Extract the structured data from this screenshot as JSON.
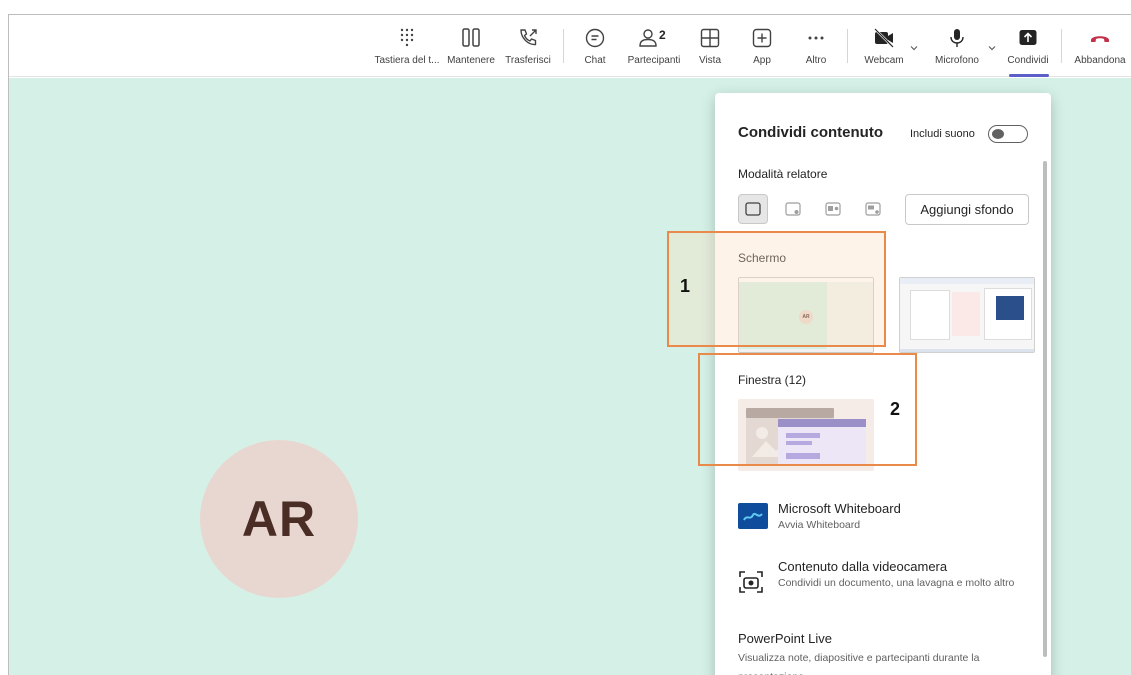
{
  "toolbar": {
    "dialpad_label": "Tastiera del t...",
    "hold_label": "Mantenere",
    "transfer_label": "Trasferisci",
    "chat_label": "Chat",
    "participants_label": "Partecipanti",
    "participants_count": "2",
    "view_label": "Vista",
    "apps_label": "App",
    "more_label": "Altro",
    "webcam_label": "Webcam",
    "mic_label": "Microfono",
    "share_label": "Condividi",
    "leave_label": "Abbandona",
    "leave_color": "#c4314b",
    "accent": "#5b5fc7"
  },
  "stage": {
    "avatar_initials": "AR",
    "background": "#d5f1e7"
  },
  "share_panel": {
    "title": "Condividi contenuto",
    "include_sound_label": "Includi suono",
    "include_sound_on": false,
    "presenter_mode_label": "Modalità relatore",
    "add_background_label": "Aggiungi sfondo",
    "screen_section_label": "Schermo",
    "window_section_label": "Finestra (12)",
    "thumb_avatar_text": "AR",
    "options": [
      {
        "title": "Microsoft Whiteboard",
        "subtitle": "Avvia Whiteboard",
        "icon": "whiteboard-icon"
      },
      {
        "title": "Contenuto dalla videocamera",
        "subtitle": "Condividi un documento, una lavagna e molto altro",
        "icon": "camera-content-icon"
      },
      {
        "title": "PowerPoint Live",
        "subtitle": "Visualizza note, diapositive e partecipanti durante la presentazione.",
        "icon": ""
      }
    ]
  },
  "annotations": {
    "callout_1": "1",
    "callout_2": "2",
    "color": "#e98a4a"
  }
}
